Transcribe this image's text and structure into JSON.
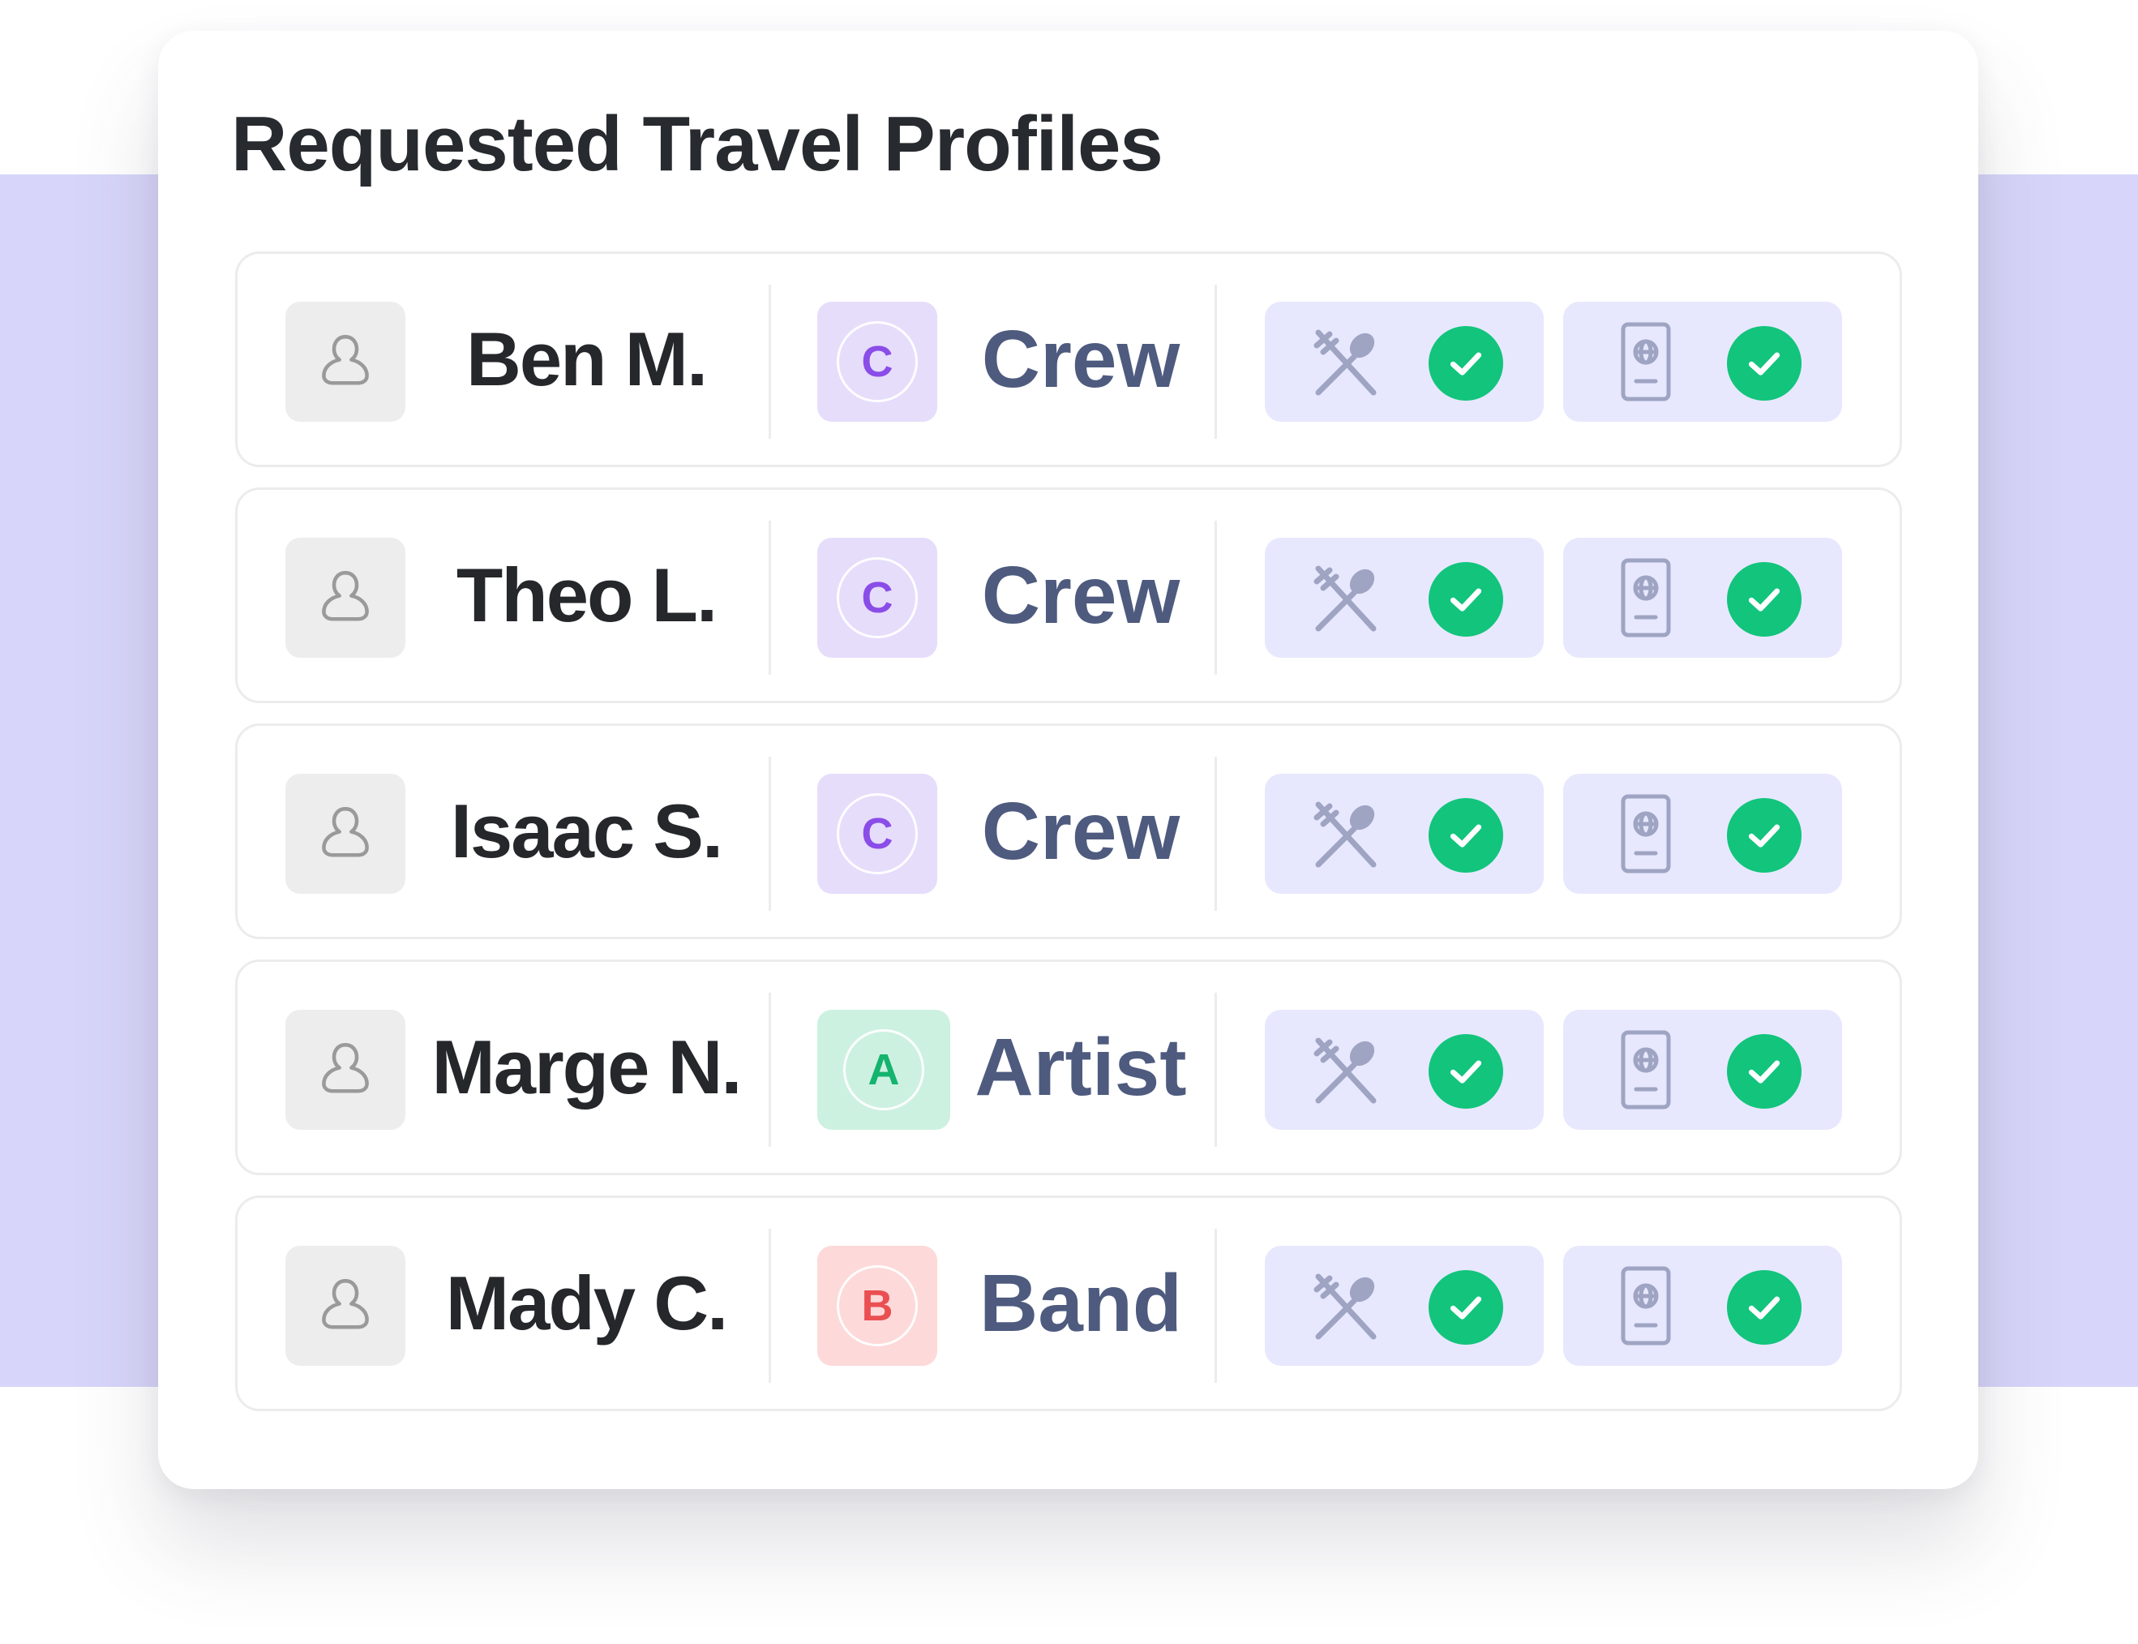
{
  "title": "Requested Travel Profiles",
  "colors": {
    "crew_badge_bg": "#e6ddfb",
    "crew_badge_fg": "#8a4de8",
    "artist_badge_bg": "#cdf1e1",
    "artist_badge_fg": "#14b36e",
    "band_badge_bg": "#fdd9d9",
    "band_badge_fg": "#ea4f52",
    "check": "#12c47c",
    "pill_bg": "#e7e8fd",
    "icon_gray": "#9ea4c2"
  },
  "profiles": [
    {
      "name": "Ben M.",
      "role": "Crew",
      "role_initial": "C",
      "role_color": "crew",
      "meal_status": "complete",
      "passport_status": "complete"
    },
    {
      "name": "Theo L.",
      "role": "Crew",
      "role_initial": "C",
      "role_color": "crew",
      "meal_status": "complete",
      "passport_status": "complete"
    },
    {
      "name": "Isaac S.",
      "role": "Crew",
      "role_initial": "C",
      "role_color": "crew",
      "meal_status": "complete",
      "passport_status": "complete"
    },
    {
      "name": "Marge N.",
      "role": "Artist",
      "role_initial": "A",
      "role_color": "artist",
      "meal_status": "complete",
      "passport_status": "complete"
    },
    {
      "name": "Mady C.",
      "role": "Band",
      "role_initial": "B",
      "role_color": "band",
      "meal_status": "complete",
      "passport_status": "complete"
    }
  ],
  "icons": {
    "avatar": "person-outline-icon",
    "meal": "fork-spoon-icon",
    "passport": "passport-icon",
    "status": "check-circle-icon"
  }
}
